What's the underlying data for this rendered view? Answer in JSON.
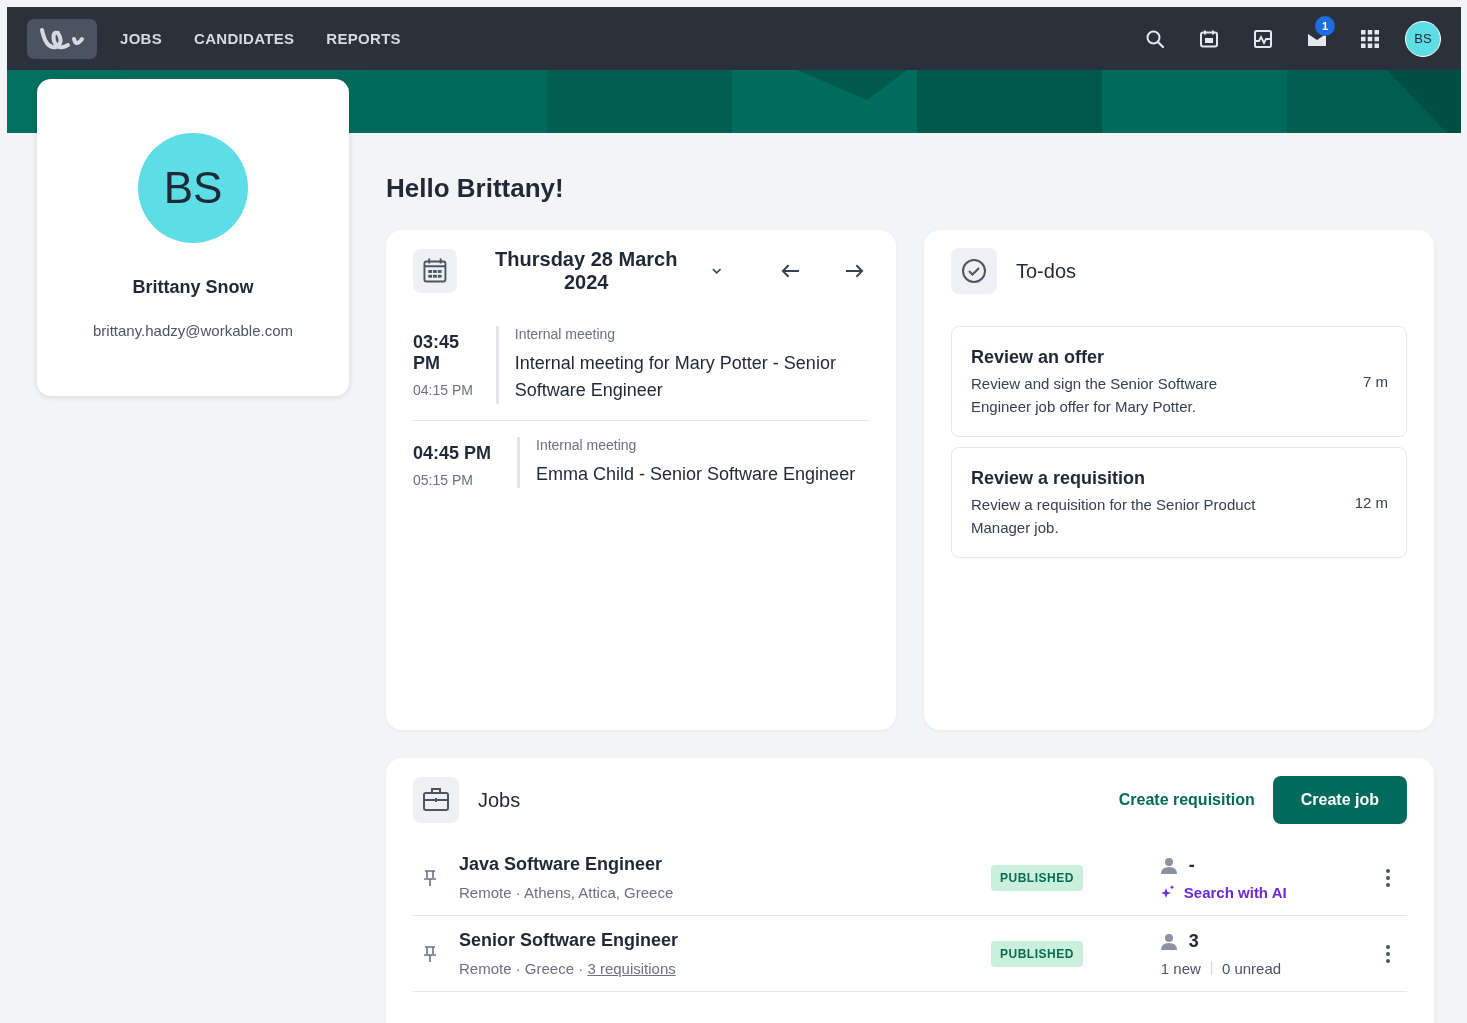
{
  "nav": {
    "items": [
      {
        "label": "JOBS",
        "selected": false
      },
      {
        "label": "CANDIDATES",
        "selected": false
      },
      {
        "label": "REPORTS",
        "selected": false
      }
    ],
    "inbox_badge": "1",
    "avatar": "BS"
  },
  "profile": {
    "initials": "BS",
    "name": "Brittany Snow",
    "email": "brittany.hadzy@workable.com"
  },
  "greeting": "Hello Brittany!",
  "calendar": {
    "date": "Thursday 28 March 2024",
    "events": [
      {
        "start": "03:45 PM",
        "end": "04:15 PM",
        "type": "Internal meeting",
        "title": "Internal meeting for Mary Potter - Senior Software Engineer"
      },
      {
        "start": "04:45 PM",
        "end": "05:15 PM",
        "type": "Internal meeting",
        "title": "Emma Child - Senior Software Engineer"
      }
    ]
  },
  "todos": {
    "title": "To-dos",
    "items": [
      {
        "title": "Review an offer",
        "text": "Review and sign the Senior Software Engineer job offer for Mary Potter.",
        "age": "7 m"
      },
      {
        "title": "Review a requisition",
        "text": "Review a requisition for the Senior Product Manager job.",
        "age": "12 m"
      }
    ]
  },
  "jobs": {
    "title": "Jobs",
    "secondary_action": "Create requisition",
    "primary_action": "Create job",
    "rows": [
      {
        "kind": "ai",
        "title": "Java Software Engineer",
        "meta": "Remote · Athens, Attica, Greece",
        "status": "PUBLISHED",
        "candidates": "-",
        "action": "Search with AI"
      },
      {
        "kind": "stats",
        "title": "Senior Software Engineer",
        "meta": "Remote · Greece · ",
        "link": "3 requisitions",
        "status": "PUBLISHED",
        "candidates": "3",
        "new": "1 new",
        "unread": "0 unread"
      }
    ]
  }
}
